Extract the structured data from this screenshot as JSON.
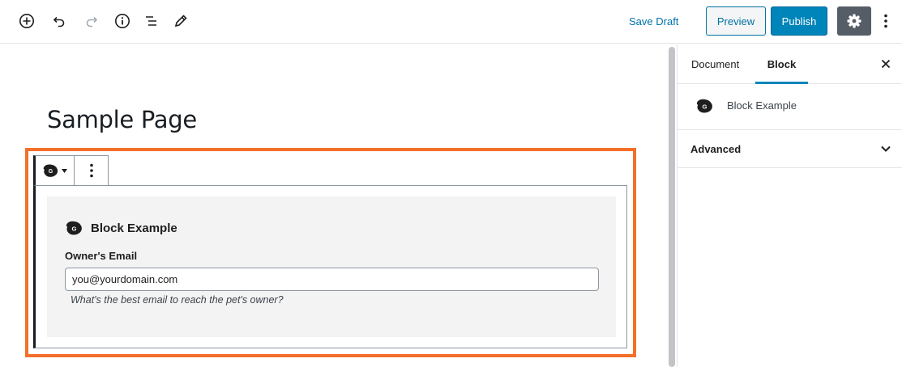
{
  "toolbar": {
    "icons": [
      "add-block-icon",
      "undo-icon",
      "redo-icon",
      "info-icon",
      "block-navigation-icon",
      "edit-icon"
    ],
    "save_draft": "Save Draft",
    "preview": "Preview",
    "publish": "Publish",
    "settings_icon": "gear-icon",
    "more_icon": "more-vertical-icon"
  },
  "editor": {
    "page_title": "Sample Page",
    "block": {
      "name": "Block Example",
      "field_label": "Owner's Email",
      "field_value": "you@yourdomain.com",
      "field_help": "What's the best email to reach the pet's owner?"
    }
  },
  "sidebar": {
    "tabs": [
      {
        "label": "Document",
        "active": false
      },
      {
        "label": "Block",
        "active": true
      }
    ],
    "block_card_title": "Block Example",
    "panel_title": "Advanced"
  },
  "colors": {
    "accent": "#0085ba",
    "highlight": "#f36f2a",
    "settings_bg": "#555d66",
    "block_bg": "#f3f3f3"
  }
}
